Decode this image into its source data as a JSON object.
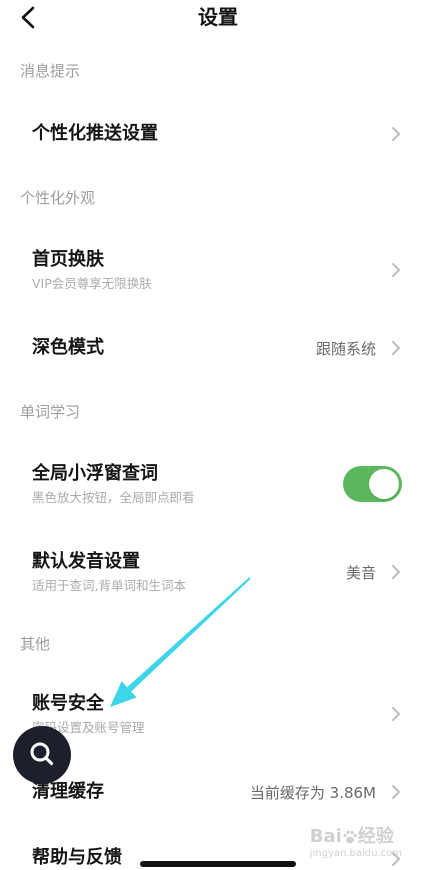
{
  "header": {
    "title": "设置",
    "back_icon": "chevron-left-icon"
  },
  "sections": [
    {
      "label": "消息提示",
      "items": [
        {
          "title": "个性化推送设置",
          "control": "chevron"
        }
      ]
    },
    {
      "label": "个性化外观",
      "items": [
        {
          "title": "首页换肤",
          "subtitle": "VIP会员尊享无限换肤",
          "control": "chevron"
        },
        {
          "title": "深色模式",
          "value": "跟随系统",
          "control": "chevron"
        }
      ]
    },
    {
      "label": "单词学习",
      "items": [
        {
          "title": "全局小浮窗查词",
          "subtitle": "黑色放大按钮，全局即点即看",
          "control": "toggle",
          "toggle_on": true
        },
        {
          "title": "默认发音设置",
          "subtitle": "适用于查词,背单词和生词本",
          "value": "美音",
          "control": "chevron"
        }
      ]
    },
    {
      "label": "其他",
      "items": [
        {
          "title": "账号安全",
          "subtitle": "密码设置及账号管理",
          "control": "chevron"
        },
        {
          "title": "清理缓存",
          "value": "当前缓存为 3.86M",
          "control": "chevron"
        },
        {
          "title": "帮助与反馈",
          "control": "chevron"
        }
      ]
    }
  ],
  "floating_button": {
    "icon": "search-icon"
  },
  "watermark": {
    "brand_left": "Bai",
    "brand_right": "经验",
    "url": "jingyan.baidu.com",
    "icon": "paw-icon"
  },
  "colors": {
    "toggle_on": "#5cb85c",
    "floating_button": "#1c202b",
    "annotation_arrow": "#3dd6e8",
    "section_label": "#9d9d9d",
    "chevron": "#bdbdbd"
  }
}
